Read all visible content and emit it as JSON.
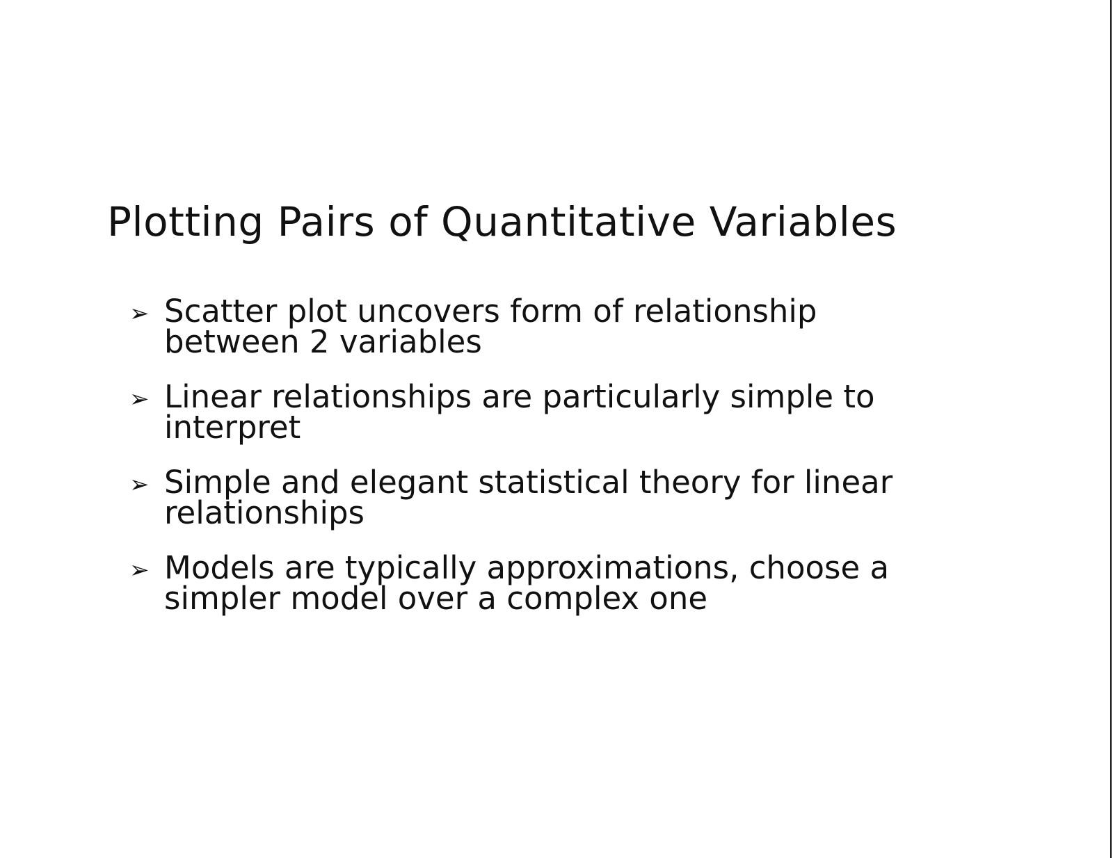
{
  "slide": {
    "title": "Plotting Pairs of Quantitative Variables",
    "bullet_icon": "arrowhead-bullet-icon",
    "bullets": [
      {
        "text": "Scatter plot uncovers form of relationship\nbetween 2 variables"
      },
      {
        "text": "Linear relationships are particularly simple to\ninterpret"
      },
      {
        "text": "Simple and elegant statistical theory for linear\nrelationships"
      },
      {
        "text": "Models are typically approximations, choose a\nsimpler model over a complex one"
      }
    ]
  }
}
